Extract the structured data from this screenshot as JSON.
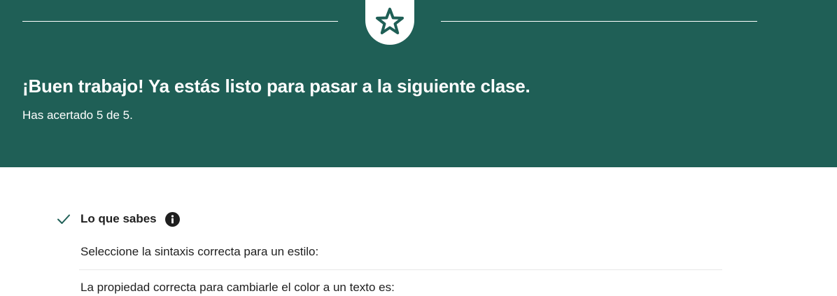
{
  "banner": {
    "background_color": "#1f5f56",
    "badge_icon": "star-icon",
    "headline": "¡Buen trabajo! Ya estás listo para pasar a la siguiente clase.",
    "score_text": "Has acertado 5 de 5."
  },
  "summary": {
    "status_icon": "check-icon",
    "title": "Lo que sabes",
    "info_icon": "info-icon",
    "questions": [
      "Seleccione la sintaxis correcta para un estilo:",
      "La propiedad correcta para cambiarle el color a un texto es:"
    ]
  }
}
